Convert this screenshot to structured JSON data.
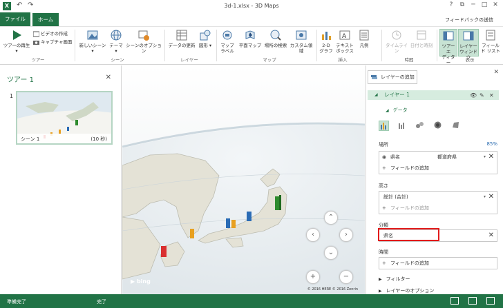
{
  "titlebar": {
    "title": "3d-1.xlsx - 3D Maps",
    "app_badge": "X",
    "help": "?",
    "restore_icon": "⧉",
    "minimize": "─",
    "maximize": "□",
    "close": "✕"
  },
  "tabs": {
    "file": "ファイル",
    "home": "ホーム",
    "feedback": "フィードバックの送信"
  },
  "ribbon": {
    "tour_play": "ツアーの再生",
    "video_create": "ビデオの作成",
    "capture_screen": "キャプチャ画面",
    "group_tour": "ツアー",
    "new_scene": "新しいシーン",
    "theme": "テーマ",
    "scene_options": "シーンのオプション",
    "group_scene": "シーン",
    "refresh_data": "データの更新",
    "shapes": "図形",
    "group_layer": "レイヤー",
    "map_labels_1": "マップ",
    "map_labels_2": "ラベル",
    "flat_map": "平面マップ",
    "find_location": "場所の検索",
    "custom_regions": "カスタム領域",
    "group_map": "マップ",
    "chart_2d_1": "2-D",
    "chart_2d_2": "グラフ",
    "text_box_1": "テキスト",
    "text_box_2": "ボックス",
    "legend": "凡例",
    "group_insert": "挿入",
    "timeline": "タイムライン",
    "date_time": "日付と時刻",
    "group_time": "時間",
    "tour_editor_1": "ツアー エ",
    "tour_editor_2": "ディター",
    "layer_pane_1": "レイヤー",
    "layer_pane_2": "ウィンドウ",
    "field_list_1": "フィール",
    "field_list_2": "ド リスト",
    "group_view": "表示"
  },
  "tour_panel": {
    "title": "ツアー 1",
    "close": "✕",
    "scene_number": "1",
    "scene_caption": "シーン 1",
    "scene_duration": "(10 秒)"
  },
  "map": {
    "bing": "bing",
    "copyright": "© 2016 HERE  © 2016 Zenrin",
    "nav_up": "⌃",
    "nav_left": "‹",
    "nav_right": "›",
    "nav_down": "⌄",
    "zoom_in": "+",
    "zoom_out": "−",
    "bars": [
      {
        "color": "#2e8b2e",
        "height": 0.9
      },
      {
        "color": "#2a6bb5",
        "height": 0.55
      },
      {
        "color": "#e8a020",
        "height": 0.6
      },
      {
        "color": "#e8a020",
        "height": 0.45
      },
      {
        "color": "#2a6bb5",
        "height": 0.4
      },
      {
        "color": "#e8a020",
        "height": 0.5
      },
      {
        "color": "#d93030",
        "height": 0.65
      }
    ]
  },
  "layer_pane": {
    "close": "✕",
    "add_layer": "レイヤーの追加",
    "layer_name": "レイヤー 1",
    "data_section": "データ",
    "location_label": "場所",
    "location_confidence": "85%",
    "location_field": "県名",
    "location_type": "都道府県",
    "add_field": "フィールドの追加",
    "height_label": "高さ",
    "height_field": "総計 (合計)",
    "category_label": "分類",
    "category_field": "県名",
    "time_label": "時間",
    "filter_section": "フィルター",
    "layer_options_section": "レイヤーのオプション"
  },
  "status": {
    "ready": "準備完了",
    "done": "完了"
  },
  "colors": {
    "accent": "#217346",
    "highlight": "#e21b1b"
  }
}
